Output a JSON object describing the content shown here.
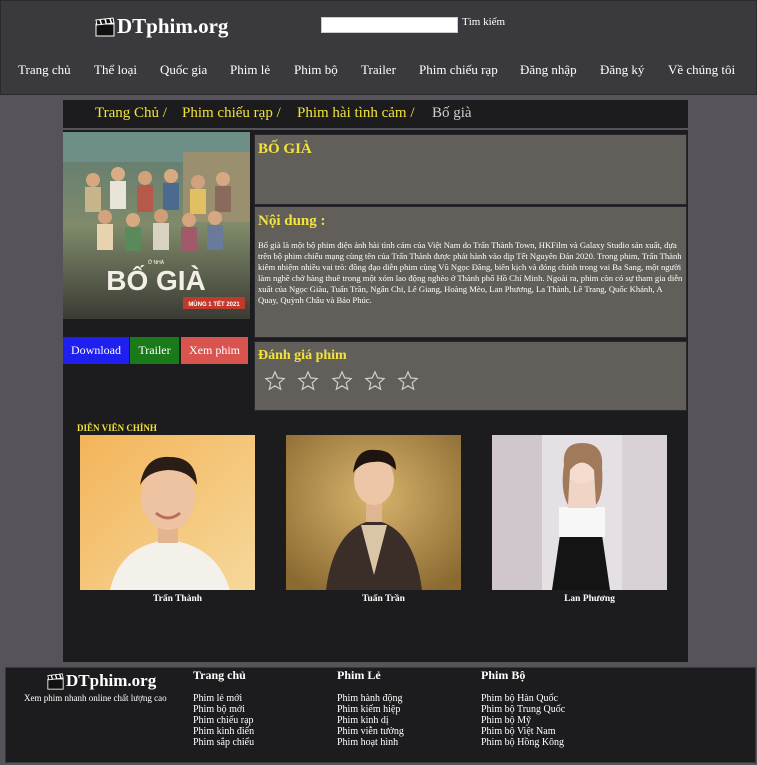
{
  "header": {
    "logo": "DTphim.org",
    "search_placeholder": "",
    "search_button": "Tìm kiếm"
  },
  "nav": {
    "items": [
      "Trang chủ",
      "Thể loại",
      "Quốc gia",
      "Phim lẻ",
      "Phim bộ",
      "Trailer",
      "Phim chiếu rạp",
      "Đăng nhập",
      "Đăng ký",
      "Về chúng tôi"
    ]
  },
  "breadcrumb": {
    "items": [
      "Trang Chủ /",
      "Phim chiếu rạp /",
      "Phim hài tình cảm /"
    ],
    "current": "Bố già"
  },
  "movie": {
    "title": "BỐ GIÀ",
    "content_heading": "Nội dung :",
    "description": "Bố già là một bộ phim điện ảnh hài tình cảm của Việt Nam do Trấn Thành Town, HKFilm và Galaxy Studio sản xuất, dựa trên bộ phim chiếu mạng cùng tên của Trấn Thành được phát hành vào dịp Tết Nguyên Đán 2020. Trong phim, Trấn Thành kiêm nhiệm nhiều vai trò: đồng đạo diễn phim cùng Vũ Ngọc Đãng, biên kịch và đóng chính trong vai Ba Sang, một người làm nghề chở hàng thuê trong một xóm lao động nghèo ở Thành phố Hồ Chí Minh. Ngoài ra, phim còn có sự tham gia diễn xuất của Ngọc Giàu, Tuấn Trần, Ngân Chi, Lê Giang, Hoàng Mèo, Lan Phương, La Thành, Lê Trang, Quốc Khánh, A Quay, Quỳnh Châu và Bảo Phúc.",
    "rating_heading": "Đánh giá phim",
    "rating_value": 0,
    "rating_max": 5,
    "poster_title": "BỐ GIÀ",
    "poster_date": "MÙNG 1 TẾT 2021"
  },
  "actions": {
    "download": "Download",
    "trailer": "Trailer",
    "watch": "Xem phim"
  },
  "cast": {
    "heading": "DIỄN VIÊN CHÍNH",
    "members": [
      {
        "name": "Trấn Thành"
      },
      {
        "name": "Tuấn Trần"
      },
      {
        "name": "Lan Phương"
      }
    ]
  },
  "footer": {
    "logo": "DTphim.org",
    "tagline": "Xem phim nhanh online chất lượng cao",
    "columns": [
      {
        "heading": "Trang chủ",
        "links": [
          "Phim lẻ mới",
          "Phim bộ mới",
          "Phim chiếu rạp",
          "Phim kinh điển",
          "Phim sắp chiếu"
        ]
      },
      {
        "heading": "Phim Lẻ",
        "links": [
          "Phim hành động",
          "Phim kiếm hiệp",
          "Phim kinh dị",
          "Phim viễn tưởng",
          "Phim hoạt hình"
        ]
      },
      {
        "heading": "Phim Bộ",
        "links": [
          "Phim bộ Hàn Quốc",
          "Phim bộ Trung Quốc",
          "Phim bộ Mỹ",
          "Phim bộ Việt Nam",
          "Phim bộ Hồng Kông"
        ]
      }
    ]
  },
  "colors": {
    "accent_yellow": "#f3e33b",
    "download_blue": "#1f1ff0",
    "trailer_green": "#1a7a1a",
    "watch_red": "#d9534f",
    "panel_bg": "#625f5a"
  }
}
